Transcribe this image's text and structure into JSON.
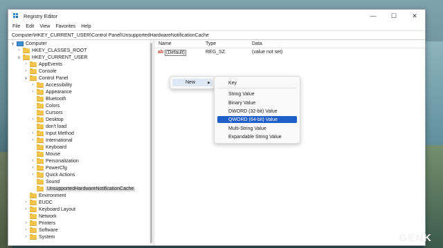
{
  "window": {
    "title": "Registry Editor",
    "minimize": "—",
    "maximize": "☐",
    "close": "✕"
  },
  "menu": [
    "File",
    "Edit",
    "View",
    "Favorites",
    "Help"
  ],
  "address": "Computer\\HKEY_CURRENT_USER\\Control Panel\\UnsupportedHardwareNotificationCache",
  "tree": {
    "root": "Computer",
    "nodes": [
      {
        "label": "HKEY_CLASSES_ROOT"
      },
      {
        "label": "HKEY_CURRENT_USER"
      },
      {
        "label": "AppEvents"
      },
      {
        "label": "Console"
      },
      {
        "label": "Control Panel"
      },
      {
        "label": "Accessibility"
      },
      {
        "label": "Appearance"
      },
      {
        "label": "Bluetooth"
      },
      {
        "label": "Colors"
      },
      {
        "label": "Cursors"
      },
      {
        "label": "Desktop"
      },
      {
        "label": "don't load"
      },
      {
        "label": "Input Method"
      },
      {
        "label": "International"
      },
      {
        "label": "Keyboard"
      },
      {
        "label": "Mouse"
      },
      {
        "label": "Personalization"
      },
      {
        "label": "PowerCfg"
      },
      {
        "label": "Quick Actions"
      },
      {
        "label": "Sound"
      },
      {
        "label": "UnsupportedHardwareNotificationCache"
      },
      {
        "label": "Environment"
      },
      {
        "label": "EUDC"
      },
      {
        "label": "Keyboard Layout"
      },
      {
        "label": "Network"
      },
      {
        "label": "Printers"
      },
      {
        "label": "Software"
      },
      {
        "label": "System"
      }
    ]
  },
  "list": {
    "columns": [
      "Name",
      "Type",
      "Data"
    ],
    "rows": [
      {
        "name": "(Default)",
        "type": "REG_SZ",
        "data": "(value not set)",
        "icon": "ab-string-icon"
      }
    ]
  },
  "context_menu": {
    "new_label": "New",
    "submenu": [
      "Key",
      "String Value",
      "Binary Value",
      "DWORD (32-bit) Value",
      "QWORD (64-bit) Value",
      "Multi-String Value",
      "Expandable String Value"
    ],
    "highlighted": "QWORD (64-bit) Value"
  },
  "watermark": "GENK",
  "colors": {
    "highlight": "#1e5ec8",
    "folder": "#f4c54c"
  }
}
